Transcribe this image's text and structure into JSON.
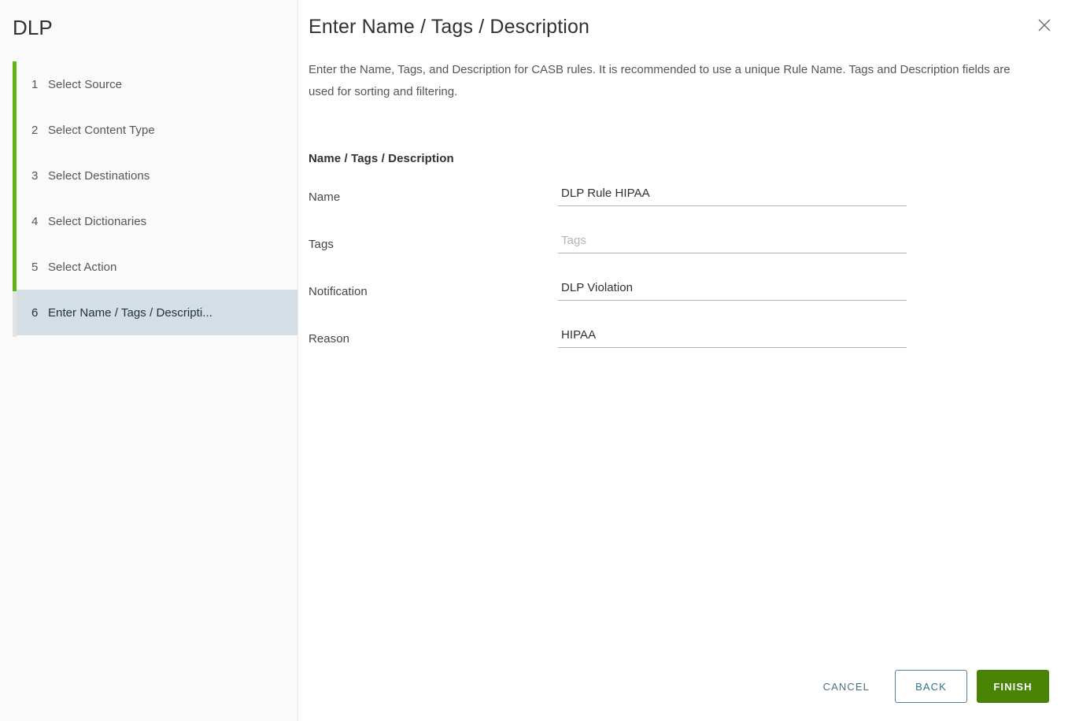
{
  "sidebar": {
    "title": "DLP",
    "steps": [
      {
        "number": "1",
        "label": "Select Source",
        "active": false
      },
      {
        "number": "2",
        "label": "Select Content Type",
        "active": false
      },
      {
        "number": "3",
        "label": "Select Destinations",
        "active": false
      },
      {
        "number": "4",
        "label": "Select Dictionaries",
        "active": false
      },
      {
        "number": "5",
        "label": "Select Action",
        "active": false
      },
      {
        "number": "6",
        "label": "Enter Name / Tags / Descripti...",
        "active": true
      }
    ]
  },
  "panel": {
    "title": "Enter Name / Tags / Description",
    "description": "Enter the Name, Tags, and Description for CASB rules. It is recommended to use a unique Rule Name. Tags and Description fields are used for sorting and filtering.",
    "close_icon": "close-icon",
    "section_heading": "Name / Tags / Description",
    "fields": [
      {
        "label": "Name",
        "value": "DLP Rule HIPAA",
        "placeholder": ""
      },
      {
        "label": "Tags",
        "value": "",
        "placeholder": "Tags"
      },
      {
        "label": "Notification",
        "value": "DLP Violation",
        "placeholder": ""
      },
      {
        "label": "Reason",
        "value": "HIPAA",
        "placeholder": ""
      }
    ]
  },
  "footer": {
    "cancel_label": "Cancel",
    "back_label": "Back",
    "finish_label": "Finish"
  },
  "colors": {
    "progress_green": "#60b515",
    "finish_green": "#4a8405",
    "link_blue": "#4f6d82",
    "active_step_bg": "#d3dee5",
    "sidebar_bg": "#fafafa"
  }
}
